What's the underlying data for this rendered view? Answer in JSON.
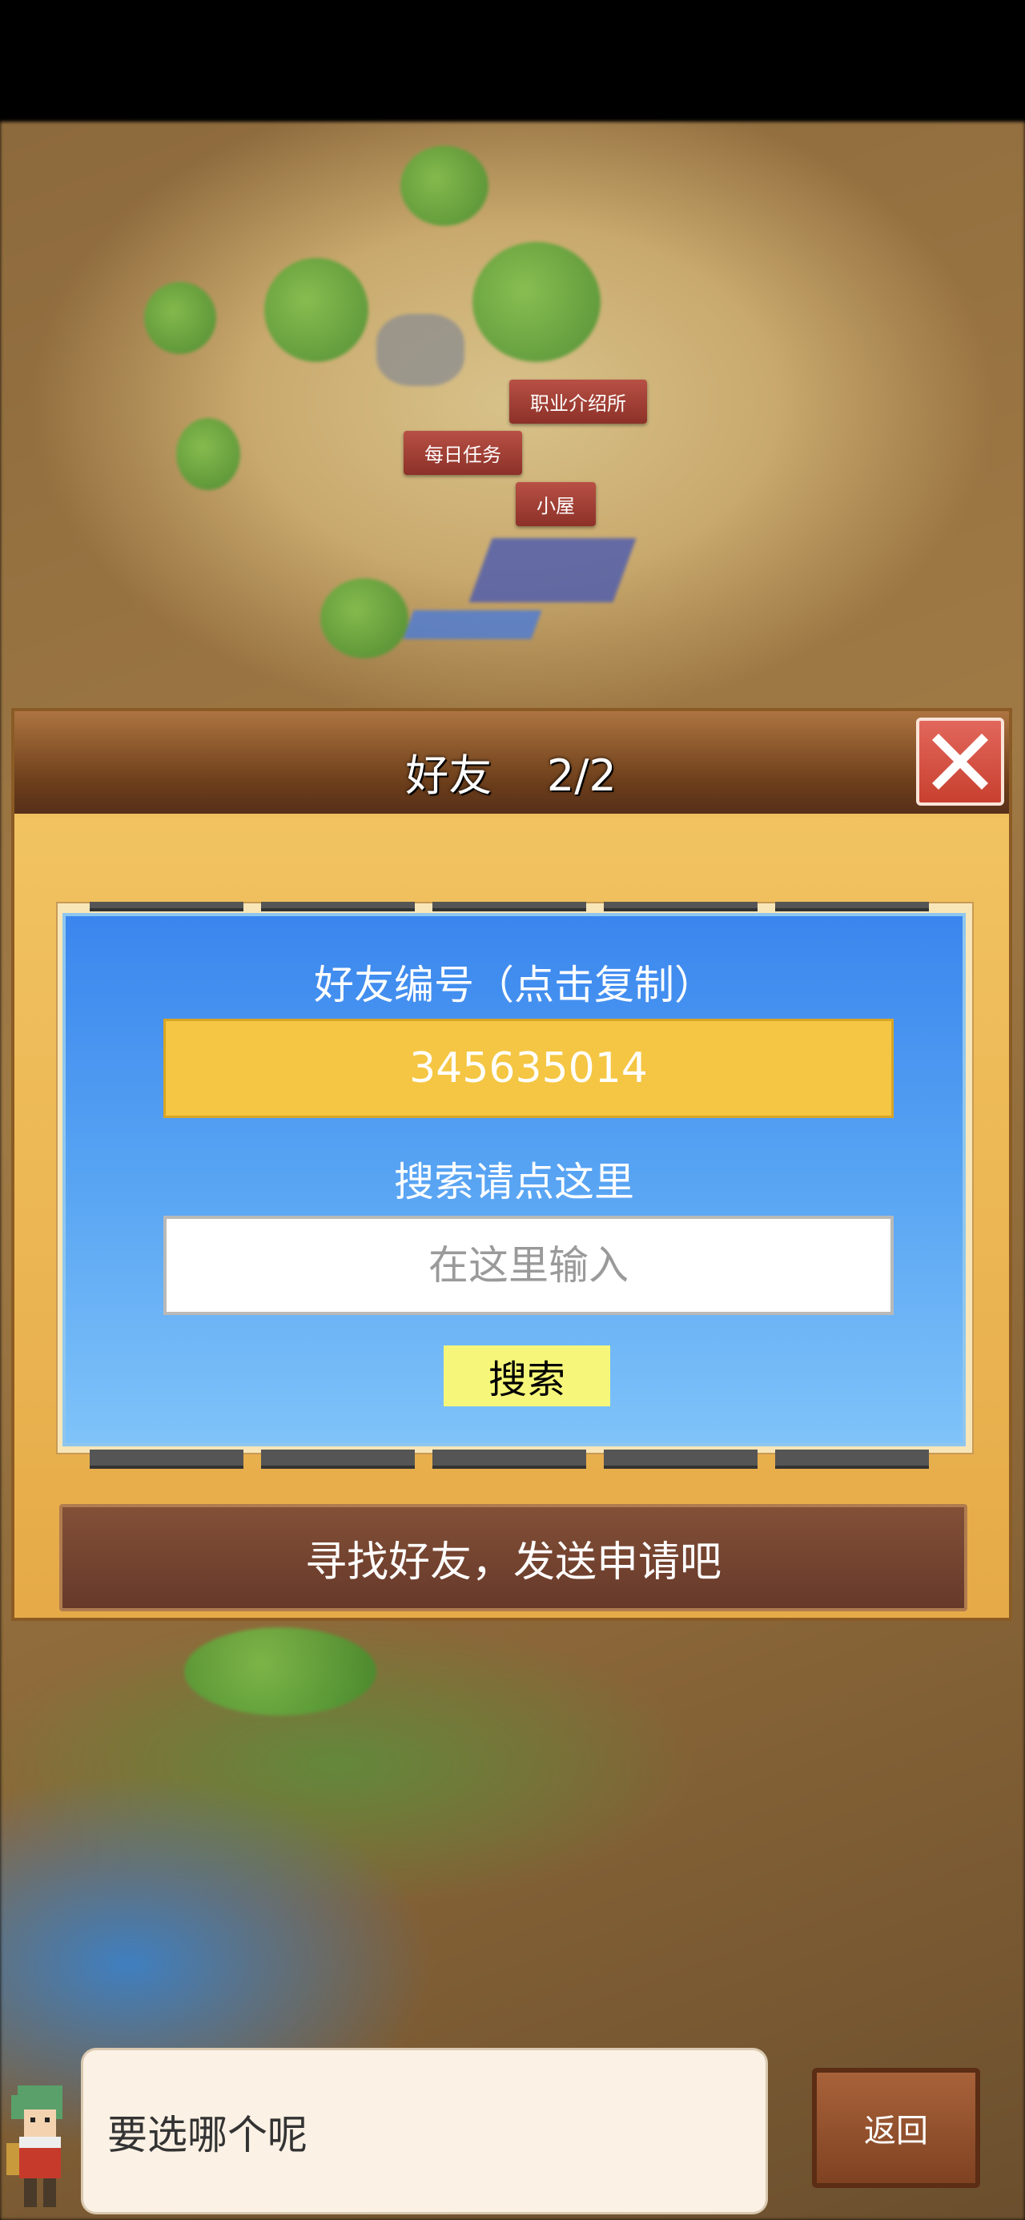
{
  "map": {
    "labels": {
      "job_agency": "职业介绍所",
      "daily_tasks": "每日任务",
      "cabin": "小屋"
    }
  },
  "dialog": {
    "title": "好友    2/2",
    "friend_id_label": "好友编号（点击复制）",
    "friend_id": "345635014",
    "search_prompt": "搜索请点这里",
    "search_placeholder": "在这里输入",
    "search_button": "搜索",
    "find_friends_button": "寻找好友，发送申请吧"
  },
  "bottom": {
    "message": "要选哪个呢",
    "back_button": "返回"
  },
  "icons": {
    "close": "close-icon",
    "left_arrow": "arrow-left-icon",
    "right_arrow": "arrow-right-icon"
  },
  "colors": {
    "panel_blue": "#3a86ee",
    "id_yellow": "#f5c643",
    "search_button_yellow": "#f6f77a",
    "close_red": "#d14c3e"
  }
}
